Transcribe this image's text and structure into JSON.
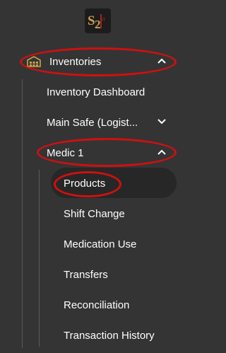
{
  "logo": {
    "text_s": "S",
    "text_2": "2",
    "text_it": "IT"
  },
  "inventories": {
    "label": "Inventories",
    "icon": "warehouse-icon",
    "expanded": true
  },
  "inventory_dashboard": {
    "label": "Inventory Dashboard"
  },
  "main_safe": {
    "label": "Main Safe (Logist...",
    "expanded": false
  },
  "medic1": {
    "label": "Medic 1",
    "expanded": true,
    "items": [
      {
        "label": "Products"
      },
      {
        "label": "Shift Change"
      },
      {
        "label": "Medication Use"
      },
      {
        "label": "Transfers"
      },
      {
        "label": "Reconciliation"
      },
      {
        "label": "Transaction History"
      }
    ],
    "active_index": 0
  },
  "colors": {
    "background": "#343434",
    "active_background": "#272727",
    "highlight_annotation": "#d01010",
    "text": "#ffffff",
    "logo_gold": "#c9a24a",
    "logo_red": "#c62828"
  }
}
